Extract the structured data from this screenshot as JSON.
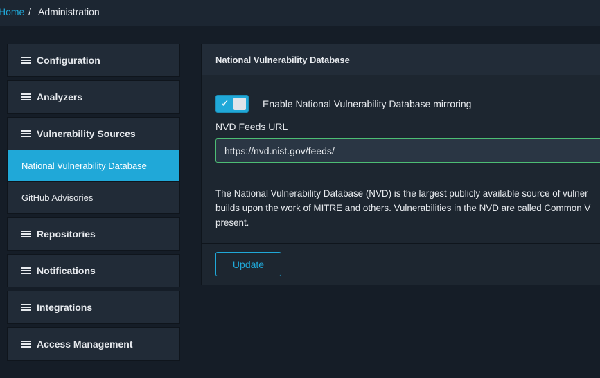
{
  "breadcrumb": {
    "home": "Home",
    "separator": "/",
    "current": "Administration"
  },
  "sidebar": {
    "groups": [
      {
        "label": "Configuration"
      },
      {
        "label": "Analyzers"
      },
      {
        "label": "Vulnerability Sources",
        "items": [
          {
            "label": "National Vulnerability Database",
            "active": true
          },
          {
            "label": "GitHub Advisories"
          }
        ]
      },
      {
        "label": "Repositories"
      },
      {
        "label": "Notifications"
      },
      {
        "label": "Integrations"
      },
      {
        "label": "Access Management"
      }
    ]
  },
  "card": {
    "title": "National Vulnerability Database",
    "toggle": {
      "label": "Enable National Vulnerability Database mirroring",
      "checked": true,
      "check_glyph": "✓"
    },
    "feeds_url": {
      "label": "NVD Feeds URL",
      "value": "https://nvd.nist.gov/feeds/"
    },
    "description_lines": [
      "The National Vulnerability Database (NVD) is the largest publicly available source of vulner",
      "builds upon the work of MITRE and others. Vulnerabilities in the NVD are called Common V",
      "present."
    ],
    "update_label": "Update"
  },
  "colors": {
    "accent": "#20a8d8",
    "success_border": "#4dbd74",
    "background": "#151d27"
  }
}
